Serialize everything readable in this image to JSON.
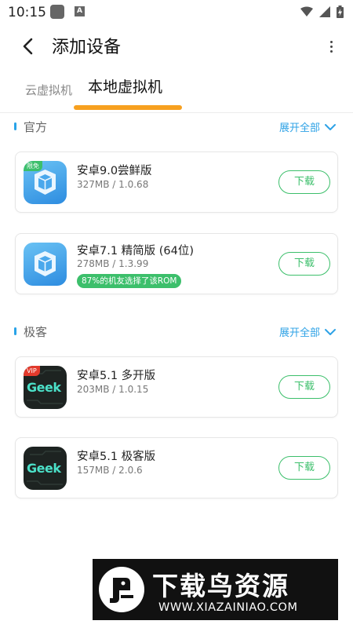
{
  "status_bar": {
    "time": "10:15",
    "icons": [
      "app-square-icon",
      "a-notification-icon",
      "wifi-icon",
      "signal-icon",
      "battery-charging-icon"
    ]
  },
  "header": {
    "title": "添加设备",
    "back_icon": "back-arrow-icon",
    "more_icon": "more-vertical-icon"
  },
  "tabs": [
    {
      "label": "云虚拟机",
      "active": false
    },
    {
      "label": "本地虚拟机",
      "active": true
    }
  ],
  "colors": {
    "accent_tab": "#f7a01f",
    "link_blue": "#2ea2e6",
    "download_green": "#3cbf6b"
  },
  "sections": [
    {
      "title": "官方",
      "expand_label": "展开全部",
      "items": [
        {
          "icon": "vm-cube-icon",
          "tag": "限免",
          "title": "安卓9.0尝鲜版",
          "meta": "327MB / 1.0.68",
          "badge": "",
          "button": "下载"
        },
        {
          "icon": "vm-cube-icon",
          "tag": "",
          "title": "安卓7.1 精简版 (64位)",
          "meta": "278MB / 1.3.99",
          "badge": "87%的机友选择了该ROM",
          "button": "下载"
        }
      ]
    },
    {
      "title": "极客",
      "expand_label": "展开全部",
      "items": [
        {
          "icon": "geek-logo-icon",
          "tag": "VIP",
          "icon_text": "Geek",
          "title": "安卓5.1 多开版",
          "meta": "203MB / 1.0.15",
          "badge": "",
          "button": "下载"
        },
        {
          "icon": "geek-logo-icon",
          "tag": "",
          "icon_text": "Geek",
          "title": "安卓5.1 极客版",
          "meta": "157MB / 2.0.6",
          "badge": "",
          "button": "下载"
        }
      ]
    }
  ],
  "watermark": {
    "title": "下载鸟资源",
    "url": "WWW.XIAZAINIAO.COM"
  }
}
